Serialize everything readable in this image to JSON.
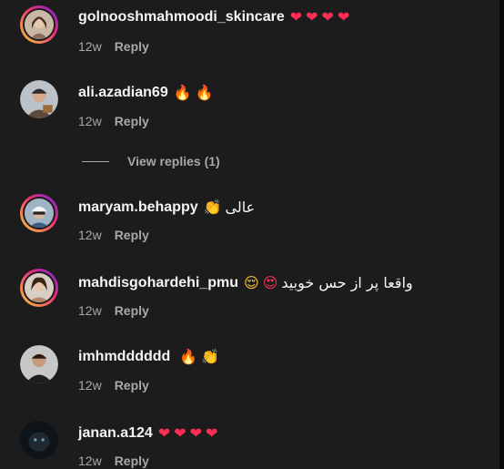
{
  "comments": [
    {
      "username": "golnooshmahmoodi_skincare",
      "text": "",
      "emojis": [
        "❤",
        "❤",
        "❤",
        "❤"
      ],
      "time": "12w",
      "reply_label": "Reply"
    },
    {
      "username": "ali.azadian69",
      "text": "",
      "emojis": [
        "🔥",
        "🔥"
      ],
      "time": "12w",
      "reply_label": "Reply"
    },
    {
      "username": "maryam.behappy",
      "text": "عالی",
      "emojis": [
        "👏"
      ],
      "time": "12w",
      "reply_label": "Reply"
    },
    {
      "username": "mahdisgohardehi_pmu",
      "text": "واقعا پر از حس خوبید",
      "emojis": [
        "😌",
        "😍"
      ],
      "time": "12w",
      "reply_label": "Reply"
    },
    {
      "username": "imhmdddddd",
      "text": "",
      "emojis": [
        "🔥",
        "👏"
      ],
      "time": "12w",
      "reply_label": "Reply"
    },
    {
      "username": "janan.a124",
      "text": "",
      "emojis": [
        "❤",
        "❤",
        "❤",
        "❤"
      ],
      "time": "12w",
      "reply_label": "Reply"
    }
  ],
  "view_replies": "View replies (1)",
  "colors": {
    "background": "#1c1c1c",
    "muted_text": "#a8a8a8",
    "heart": "#ff2d55"
  }
}
